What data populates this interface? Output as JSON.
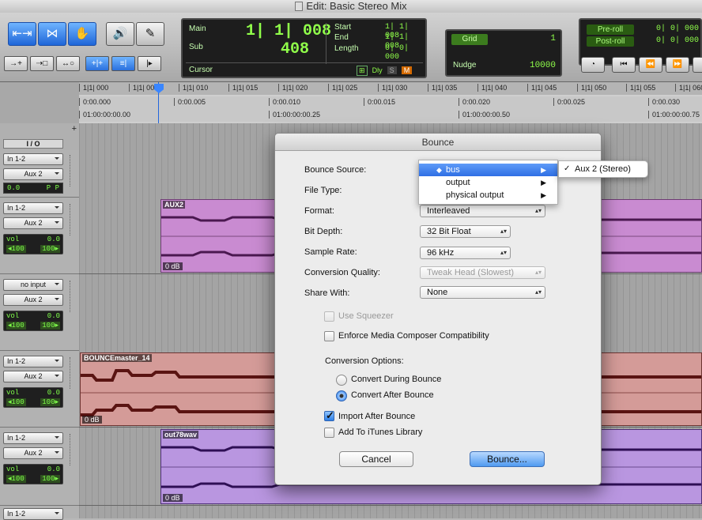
{
  "window": {
    "title": "Edit: Basic Stereo Mix"
  },
  "toolbar": {
    "tools": [
      "zoomer-icon",
      "trim-icon",
      "grabber-icon",
      "speaker-icon",
      "pencil-icon"
    ],
    "modes": [
      "shuffle-mode",
      "spot-mode",
      "slip-mode",
      "grid-mode",
      "mode-5",
      "mode-6"
    ]
  },
  "counter": {
    "main_label": "Main",
    "main_value": "1| 1| 008",
    "sub_label": "Sub",
    "sub_value": "408",
    "cursor_label": "Cursor",
    "start_label": "Start",
    "start_value": "1| 1| 008",
    "end_label": "End",
    "end_value": "1| 1| 008",
    "length_label": "Length",
    "length_value": "0| 0| 000",
    "dly_label": "Dly",
    "s_label": "S",
    "m_label": "M"
  },
  "grid": {
    "label": "Grid",
    "value": "1",
    "nudge_label": "Nudge",
    "nudge_value": "10000"
  },
  "preroll": {
    "pre_label": "Pre-roll",
    "pre_value": "0| 0| 000",
    "post_label": "Post-roll",
    "post_value": "0| 0| 000"
  },
  "ruler": {
    "bars": [
      "1|1| 000",
      "1|1| 005",
      "1|1| 010",
      "1|1| 015",
      "1|1| 020",
      "1|1| 025",
      "1|1| 030",
      "1|1| 035",
      "1|1| 040",
      "1|1| 045",
      "1|1| 050",
      "1|1| 055",
      "1|1| 060"
    ],
    "minsec": [
      "0:00.000",
      "0:00.005",
      "0:00.010",
      "0:00.015",
      "0:00.020",
      "0:00.025",
      "0:00.030"
    ],
    "timecode": [
      "01:00:00:00.00",
      "01:00:00:00.25",
      "01:00:00:00.50",
      "01:00:00:00.75"
    ]
  },
  "io_header": "I / O",
  "tracks": [
    {
      "input": "In 1-2",
      "output": "Aux 2",
      "vol_value": "0.0",
      "p1": "P",
      "p2": "P"
    },
    {
      "input": "In 1-2",
      "output": "Aux 2",
      "vol_label": "vol",
      "vol_value": "0.0",
      "pan_l": "◂100",
      "pan_r": "100▸",
      "clip": "AUX2",
      "gain": "0 dB"
    },
    {
      "input": "no input",
      "output": "Aux 2",
      "vol_label": "vol",
      "vol_value": "0.0",
      "pan_l": "◂100",
      "pan_r": "100▸"
    },
    {
      "input": "In 1-2",
      "output": "Aux 2",
      "vol_label": "vol",
      "vol_value": "0.0",
      "pan_l": "◂100",
      "pan_r": "100▸",
      "clip": "BOUNCEmaster_14",
      "gain": "0 dB"
    },
    {
      "input": "In 1-2",
      "output": "Aux 2",
      "vol_label": "vol",
      "vol_value": "0.0",
      "pan_l": "◂100",
      "pan_r": "100▸",
      "clip": "out78wav",
      "gain": "0 dB"
    },
    {
      "input": "In 1-2"
    }
  ],
  "dialog": {
    "title": "Bounce",
    "bounce_source_label": "Bounce Source:",
    "file_type_label": "File Type:",
    "format_label": "Format:",
    "format_value": "Interleaved",
    "bit_depth_label": "Bit Depth:",
    "bit_depth_value": "32 Bit Float",
    "sample_rate_label": "Sample Rate:",
    "sample_rate_value": "96 kHz",
    "conversion_quality_label": "Conversion Quality:",
    "conversion_quality_value": "Tweak Head (Slowest)",
    "share_with_label": "Share With:",
    "share_with_value": "None",
    "use_squeezer": "Use Squeezer",
    "enforce_media_composer": "Enforce Media Composer Compatibility",
    "conversion_options_label": "Conversion Options:",
    "convert_during": "Convert During Bounce",
    "convert_after": "Convert After Bounce",
    "import_after": "Import After Bounce",
    "add_itunes": "Add To iTunes Library",
    "cancel": "Cancel",
    "bounce": "Bounce..."
  },
  "source_menu": {
    "items": [
      "bus",
      "output",
      "physical output"
    ],
    "submenu_item": "Aux 2 (Stereo)"
  }
}
